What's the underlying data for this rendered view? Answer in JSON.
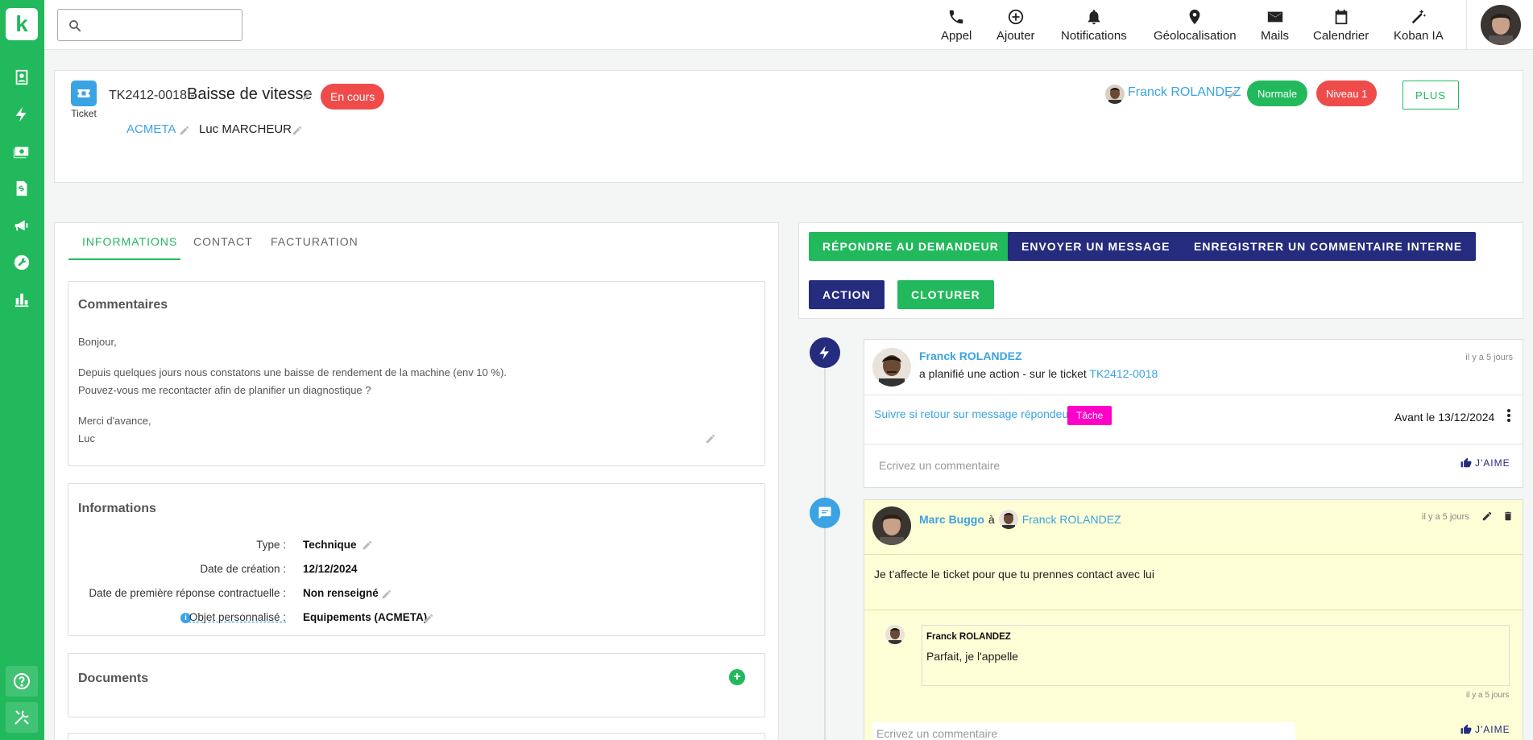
{
  "app": {
    "logo_letter": "k",
    "brand_color": "#22b95c"
  },
  "sidebar": {
    "items": [
      {
        "icon": "contacts-icon"
      },
      {
        "icon": "lightning-icon"
      },
      {
        "icon": "money-icon"
      },
      {
        "icon": "invoice-icon"
      },
      {
        "icon": "megaphone-icon"
      },
      {
        "icon": "wrench-icon"
      },
      {
        "icon": "bar-chart-icon"
      }
    ],
    "bottom": [
      {
        "icon": "help-icon"
      },
      {
        "icon": "tools-icon"
      }
    ]
  },
  "search": {
    "placeholder": "",
    "value": ""
  },
  "topnav": [
    {
      "label": "Appel",
      "icon": "phone-icon"
    },
    {
      "label": "Ajouter",
      "icon": "add-circle-icon"
    },
    {
      "label": "Notifications",
      "icon": "bell-icon"
    },
    {
      "label": "Géolocalisation",
      "icon": "location-pin-icon"
    },
    {
      "label": "Mails",
      "icon": "mail-icon"
    },
    {
      "label": "Calendrier",
      "icon": "calendar-icon"
    },
    {
      "label": "Koban IA",
      "icon": "magic-wand-icon"
    }
  ],
  "ticket": {
    "icon_label": "Ticket",
    "ref": "TK2412-0018 -",
    "title": "Baisse de vitesse",
    "status": "En cours",
    "company": "ACMETA",
    "contact": "Luc MARCHEUR",
    "owner": "Franck ROLANDEZ",
    "priority": "Normale",
    "level": "Niveau 1",
    "more_label": "PLUS"
  },
  "tabs": [
    {
      "label": "INFORMATIONS",
      "active": true
    },
    {
      "label": "CONTACT",
      "active": false
    },
    {
      "label": "FACTURATION",
      "active": false
    }
  ],
  "comments_section": {
    "title": "Commentaires",
    "lines": [
      "Bonjour,",
      "Depuis quelques jours nous constatons une baisse de rendement de la machine (env 10 %).",
      "Pouvez-vous me recontacter afin de planifier un diagnostique ?",
      "Merci d'avance,",
      "Luc"
    ]
  },
  "info_section": {
    "title": "Informations",
    "rows": [
      {
        "label": "Type :",
        "value": "Technique"
      },
      {
        "label": "Date de création :",
        "value": "12/12/2024"
      },
      {
        "label": "Date de première réponse contractuelle :",
        "value": "Non renseigné"
      },
      {
        "label": "Objet personnalisé :",
        "value": "Equipements (ACMETA)"
      }
    ]
  },
  "documents_section": {
    "title": "Documents"
  },
  "actions": {
    "reply": "RÉPONDRE AU DEMANDEUR",
    "send": "ENVOYER UN MESSAGE",
    "internal": "ENREGISTRER UN COMMENTAIRE INTERNE",
    "action": "ACTION",
    "close": "CLOTURER"
  },
  "timeline": {
    "entry1": {
      "author": "Franck ROLANDEZ",
      "text": "a planifié une action - sur le ticket",
      "ticket_link": "TK2412-0018",
      "time": "il y a 5 jours",
      "task_text": "Suivre si retour sur message répondeur",
      "task_badge": "Tâche",
      "task_badge_color": "#ff00c8",
      "due": "Avant le 13/12/2024",
      "comment_placeholder": "Ecrivez un commentaire",
      "like": "J'AIME"
    },
    "entry2": {
      "author": "Marc Buggo",
      "to_word": "à",
      "recipient": "Franck ROLANDEZ",
      "time": "il y a 5 jours",
      "message": "Je t'affecte le ticket pour que tu prennes contact avec lui",
      "reply_author": "Franck ROLANDEZ",
      "reply_text": "Parfait, je l'appelle",
      "reply_time": "il y a 5 jours",
      "comment_placeholder": "Ecrivez un commentaire",
      "like": "J'AIME",
      "bg_color": "#fdfdd6"
    }
  }
}
